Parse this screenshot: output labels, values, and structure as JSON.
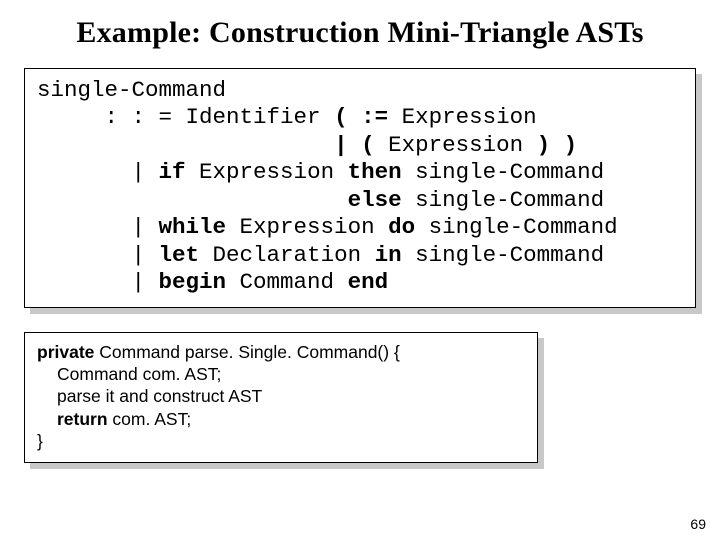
{
  "title": "Example: Construction Mini-Triangle ASTs",
  "grammar": {
    "l1": "single-Command",
    "l2a": "     : : = Identifier ",
    "l2b": "( := ",
    "l2c": "Expression",
    "l3a": "                      ",
    "l3b": "| ( ",
    "l3c": "Expression ",
    "l3d": ") )",
    "l4a": "       | ",
    "l4b": "if ",
    "l4c": "Expression ",
    "l4d": "then ",
    "l4e": "single-Command",
    "l5a": "                       ",
    "l5b": "else ",
    "l5c": "single-Command",
    "l6a": "       | ",
    "l6b": "while ",
    "l6c": "Expression ",
    "l6d": "do ",
    "l6e": "single-Command",
    "l7a": "       | ",
    "l7b": "let ",
    "l7c": "Declaration ",
    "l7d": "in ",
    "l7e": "single-Command",
    "l8a": "       | ",
    "l8b": "begin ",
    "l8c": "Command ",
    "l8d": "end"
  },
  "code": {
    "kw_private": "private",
    "sig_rest": " Command parse. Single. Command() {",
    "line2": "Command com. AST;",
    "line3": "parse it and construct AST",
    "kw_return": "return",
    "line4_rest": " com. AST;",
    "line5": "}"
  },
  "page_number": "69"
}
